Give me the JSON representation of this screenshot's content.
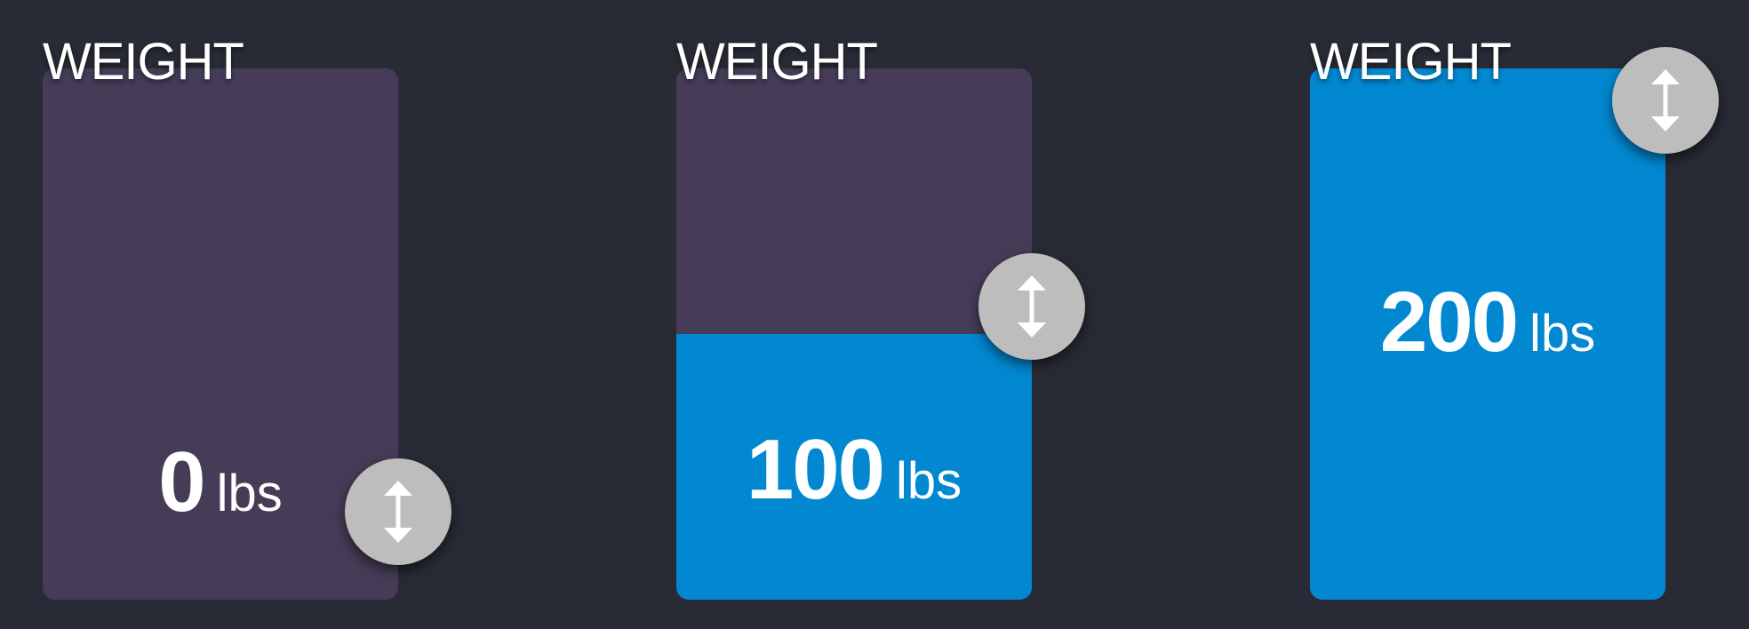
{
  "colors": {
    "background": "#282b35",
    "track": "#463c57",
    "fill": "#0288d1",
    "handle": "#bdbdbd",
    "text": "#ffffff"
  },
  "sliders": [
    {
      "label": "WEIGHT",
      "value": "0",
      "unit": "lbs",
      "fraction": 0.0,
      "handle_icon": "vertical-resize-icon"
    },
    {
      "label": "WEIGHT",
      "value": "100",
      "unit": "lbs",
      "fraction": 0.5,
      "handle_icon": "vertical-resize-icon"
    },
    {
      "label": "WEIGHT",
      "value": "200",
      "unit": "lbs",
      "fraction": 1.0,
      "handle_icon": "vertical-resize-icon"
    }
  ]
}
